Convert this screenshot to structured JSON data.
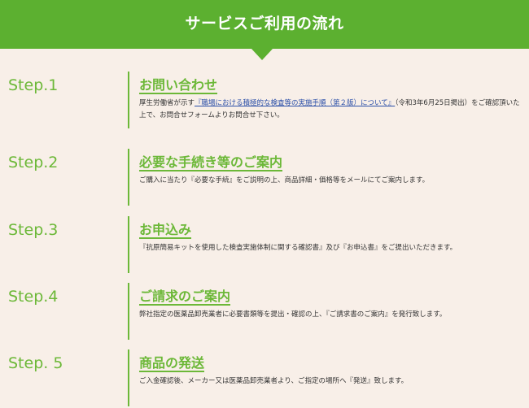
{
  "header": {
    "title": "サービスご利用の流れ"
  },
  "colors": {
    "header_bg": "#5cb030",
    "accent_green": "#6cb838",
    "page_bg": "#f8efe8",
    "link_blue": "#2b4fa8",
    "body_text": "#333333"
  },
  "steps": [
    {
      "label": "Step.1",
      "title": "お問い合わせ",
      "desc_prefix": "厚生労働省が示す",
      "desc_link": "『職場における積極的な検査等の実施手順（第２版）について』",
      "desc_suffix": "（令和3年6月25日掲出）をご確認頂いた上で、お問合せフォームよりお問合せ下さい。"
    },
    {
      "label": "Step.2",
      "title": "必要な手続き等のご案内",
      "desc": "ご購入に当たり『必要な手続』をご説明の上、商品詳細・価格等をメールにてご案内します。"
    },
    {
      "label": "Step.3",
      "title": "お申込み",
      "desc": "『抗原簡易キットを使用した検査実施体制に関する確認書』及び『お申込書』をご提出いただきます。"
    },
    {
      "label": "Step.4",
      "title": "ご請求のご案内",
      "desc": "弊社指定の医薬品卸売業者に必要書類等を提出・確認の上、『ご請求書のご案内』を発行致します。"
    },
    {
      "label": "Step. 5",
      "title": "商品の発送",
      "desc": "ご入金確認後、メーカー又は医薬品卸売業者より、ご指定の場所へ『発送』致します。"
    }
  ]
}
